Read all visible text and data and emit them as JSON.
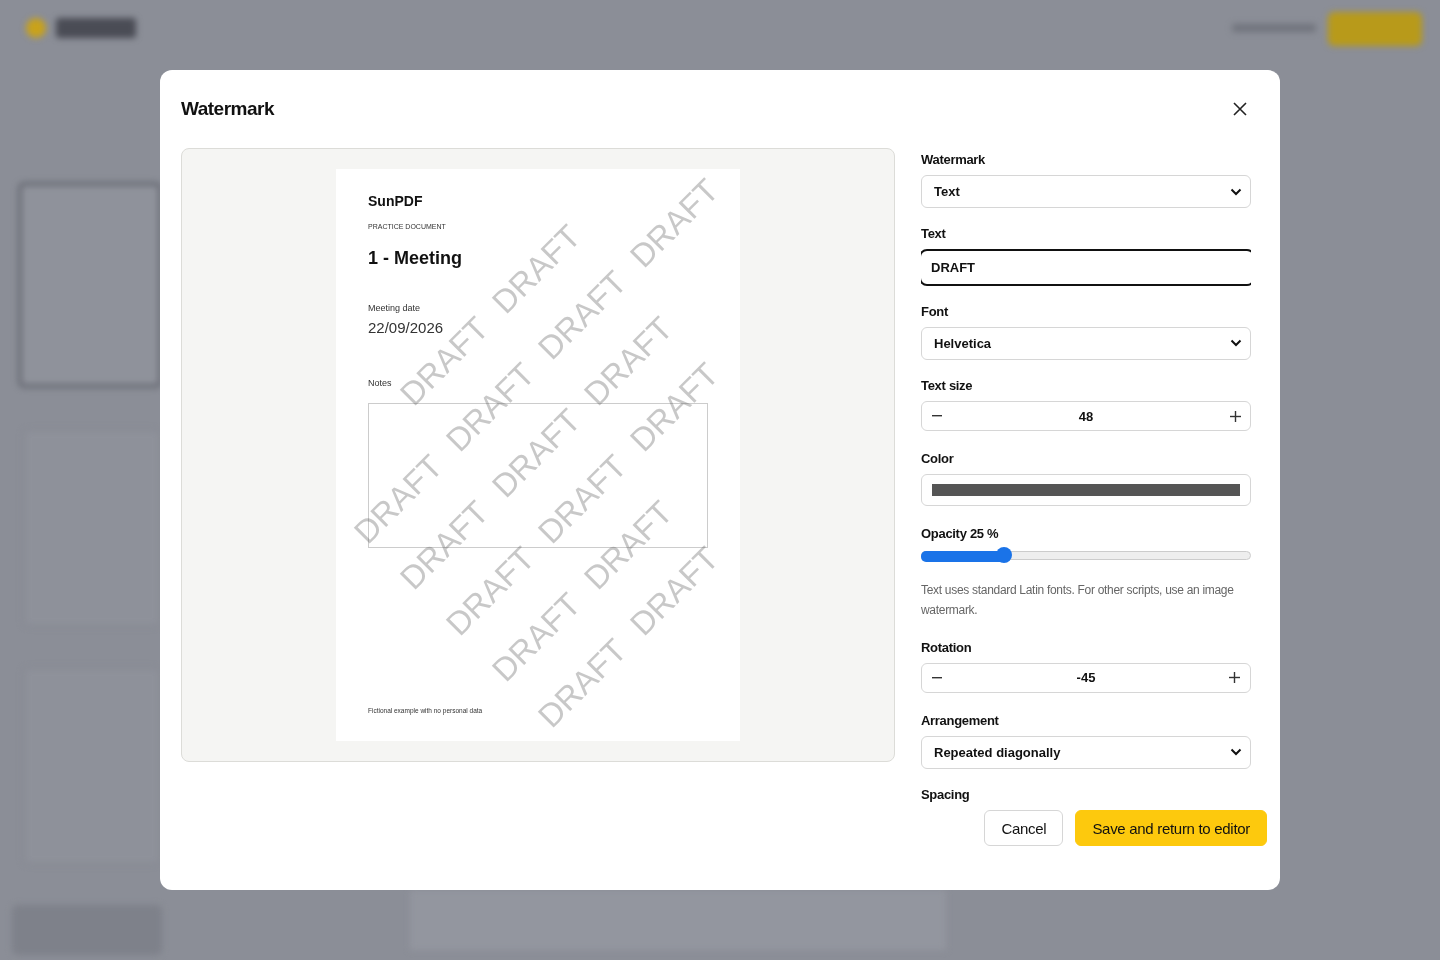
{
  "dialog": {
    "title": "Watermark"
  },
  "preview": {
    "page": {
      "brand": "SunPDF",
      "subtitle": "PRACTICE DOCUMENT",
      "heading": "1 - Meeting",
      "date_label": "Meeting date",
      "date_value": "22/09/2026",
      "notes_label": "Notes",
      "footer": "Fictional example with no personal data"
    },
    "watermark_marks": [
      {
        "text": "DRAFT"
      },
      {
        "text": "DRAFT"
      },
      {
        "text": "DRAFT"
      },
      {
        "text": "DRAFT"
      },
      {
        "text": "DRAFT"
      },
      {
        "text": "DRAFT"
      },
      {
        "text": "DRAFT"
      },
      {
        "text": "DRAFT"
      },
      {
        "text": "DRAFT"
      },
      {
        "text": "DRAFT"
      },
      {
        "text": "DRAFT"
      },
      {
        "text": "DRAFT"
      },
      {
        "text": "DRAFT"
      },
      {
        "text": "DRAFT"
      },
      {
        "text": "DRAFT"
      },
      {
        "text": "DRAFT"
      }
    ]
  },
  "settings": {
    "type": {
      "label": "Watermark",
      "value": "Text"
    },
    "text": {
      "label": "Text",
      "value": "DRAFT",
      "focused": true
    },
    "font": {
      "label": "Font",
      "value": "Helvetica"
    },
    "size": {
      "label": "Text size",
      "value": "48"
    },
    "color": {
      "label": "Color",
      "color": "#555555"
    },
    "opacity": {
      "label": "Opacity 25 %",
      "level": 0.25
    },
    "hint": "Text uses standard Latin fonts. For other scripts, use an image watermark.",
    "rotation": {
      "label": "Rotation",
      "value": "-45"
    },
    "arrangement": {
      "label": "Arrangement",
      "value": "Repeated diagonally"
    },
    "spacing": {
      "label": "Spacing"
    }
  },
  "buttons": [
    {
      "label": "Cancel",
      "kind": "secondary"
    },
    {
      "label": "Save and return to editor",
      "kind": "primary"
    }
  ]
}
